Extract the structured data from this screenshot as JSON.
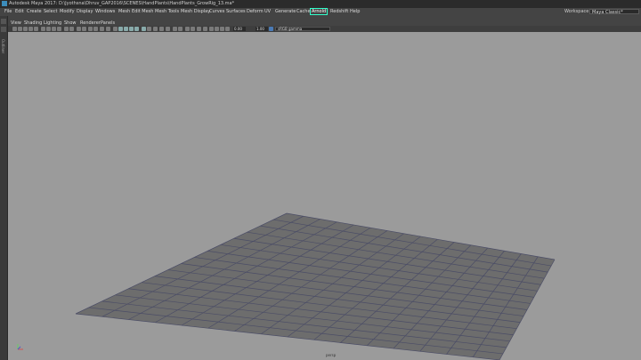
{
  "window": {
    "title": "Autodesk Maya 2017: D:\\Jyothsna\\Dhruv_GAP2016\\SCENES\\HandPlants\\HandPlants_GrowRig_13.ma*"
  },
  "menubar": {
    "items": [
      "File",
      "Edit",
      "Create",
      "Select",
      "Modify",
      "Display",
      "Windows",
      "Mesh",
      "Edit Mesh",
      "Mesh Tools",
      "Mesh Display",
      "Curves",
      "Surfaces",
      "Deform",
      "UV",
      "Generate",
      "Cache",
      "Arnold",
      "Redshift",
      "Help"
    ],
    "highlighted": "Arnold",
    "workspace_label": "Workspace :",
    "workspace_value": "Maya Classic*"
  },
  "panel_menu": {
    "items": [
      "View",
      "Shading",
      "Lighting",
      "Show",
      "Renderer",
      "Panels"
    ]
  },
  "toolbar": {
    "value_a": "0.00",
    "value_b": "1.00",
    "colorspace": "sRGB gamma"
  },
  "viewport": {
    "camera": "persp",
    "background": "#9b9b9b",
    "grid_color": "#6d6d6d",
    "grid_line_color": "#4b4d66"
  },
  "leftstrip": {
    "label": "Outliner"
  }
}
